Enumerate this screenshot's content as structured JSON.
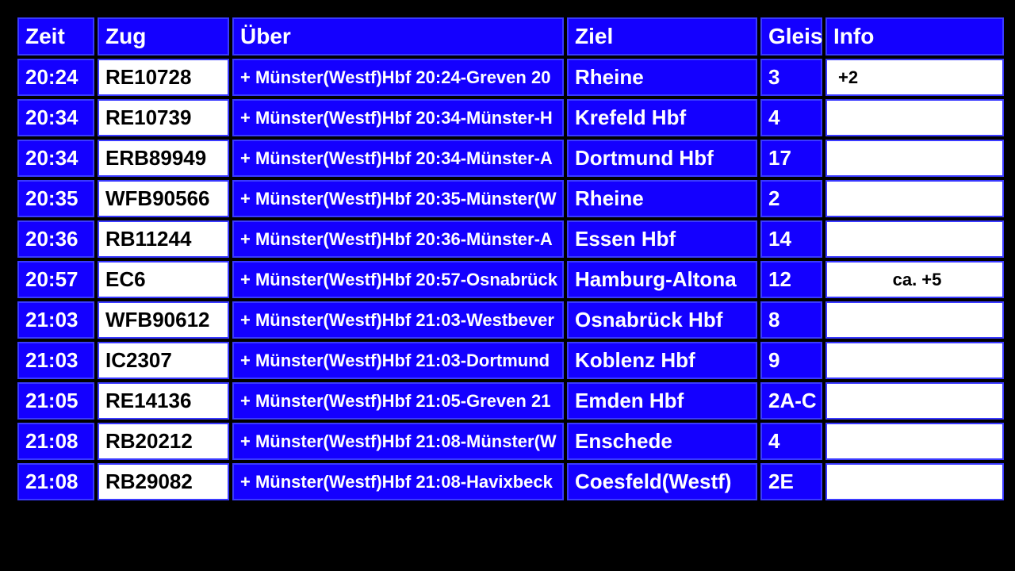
{
  "headers": {
    "zeit": "Zeit",
    "zug": "Zug",
    "ueber": "Über",
    "ziel": "Ziel",
    "gleis": "Gleis",
    "info": "Info"
  },
  "rows": [
    {
      "zeit": "20:24",
      "zug": "RE10728",
      "ueber": "+ Münster(Westf)Hbf 20:24-Greven 20",
      "ziel": "Rheine",
      "gleis": "3",
      "info": "+2",
      "info_align": "left"
    },
    {
      "zeit": "20:34",
      "zug": "RE10739",
      "ueber": "+ Münster(Westf)Hbf 20:34-Münster-H",
      "ziel": "Krefeld Hbf",
      "gleis": "4",
      "info": ""
    },
    {
      "zeit": "20:34",
      "zug": "ERB89949",
      "ueber": "+ Münster(Westf)Hbf 20:34-Münster-A",
      "ziel": "Dortmund Hbf",
      "gleis": "17",
      "info": ""
    },
    {
      "zeit": "20:35",
      "zug": "WFB90566",
      "ueber": "+ Münster(Westf)Hbf 20:35-Münster(W",
      "ziel": "Rheine",
      "gleis": "2",
      "info": ""
    },
    {
      "zeit": "20:36",
      "zug": "RB11244",
      "ueber": "+ Münster(Westf)Hbf 20:36-Münster-A",
      "ziel": "Essen Hbf",
      "gleis": "14",
      "info": ""
    },
    {
      "zeit": "20:57",
      "zug": "EC6",
      "ueber": "+ Münster(Westf)Hbf 20:57-Osnabrück",
      "ziel": "Hamburg-Altona",
      "gleis": "12",
      "info": "ca. +5",
      "info_align": "center"
    },
    {
      "zeit": "21:03",
      "zug": "WFB90612",
      "ueber": "+ Münster(Westf)Hbf 21:03-Westbever",
      "ziel": "Osnabrück Hbf",
      "gleis": "8",
      "info": ""
    },
    {
      "zeit": "21:03",
      "zug": "IC2307",
      "ueber": "+ Münster(Westf)Hbf 21:03-Dortmund",
      "ziel": "Koblenz Hbf",
      "gleis": "9",
      "info": ""
    },
    {
      "zeit": "21:05",
      "zug": "RE14136",
      "ueber": "+ Münster(Westf)Hbf 21:05-Greven 21",
      "ziel": "Emden Hbf",
      "gleis": "2A-C",
      "info": ""
    },
    {
      "zeit": "21:08",
      "zug": "RB20212",
      "ueber": "+ Münster(Westf)Hbf 21:08-Münster(W",
      "ziel": "Enschede",
      "gleis": "4",
      "info": ""
    },
    {
      "zeit": "21:08",
      "zug": "RB29082",
      "ueber": "+ Münster(Westf)Hbf 21:08-Havixbeck",
      "ziel": "Coesfeld(Westf)",
      "gleis": "2E",
      "info": ""
    }
  ]
}
